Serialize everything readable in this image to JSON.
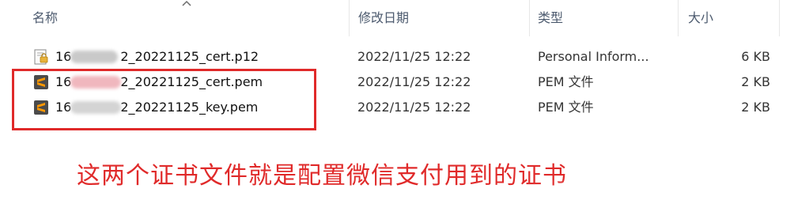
{
  "columns": {
    "name": "名称",
    "modified": "修改日期",
    "type": "类型",
    "size": "大小"
  },
  "files": [
    {
      "icon": "certificate-icon",
      "name_prefix": "16",
      "name_suffix": "2_20221125_cert.p12",
      "modified": "2022/11/25 12:22",
      "type": "Personal Inform...",
      "size": "6 KB"
    },
    {
      "icon": "sublime-text-icon",
      "name_prefix": "16",
      "name_suffix": "2_20221125_cert.pem",
      "modified": "2022/11/25 12:22",
      "type": "PEM 文件",
      "size": "2 KB"
    },
    {
      "icon": "sublime-text-icon",
      "name_prefix": "16",
      "name_suffix": "2_20221125_key.pem",
      "modified": "2022/11/25 12:22",
      "type": "PEM 文件",
      "size": "2 KB"
    }
  ],
  "annotation": "这两个证书文件就是配置微信支付用到的证书",
  "colors": {
    "annotation": "#e02a2a",
    "sublime_icon_bg": "#4b4b4b",
    "sublime_icon_fg": "#ff9800"
  }
}
